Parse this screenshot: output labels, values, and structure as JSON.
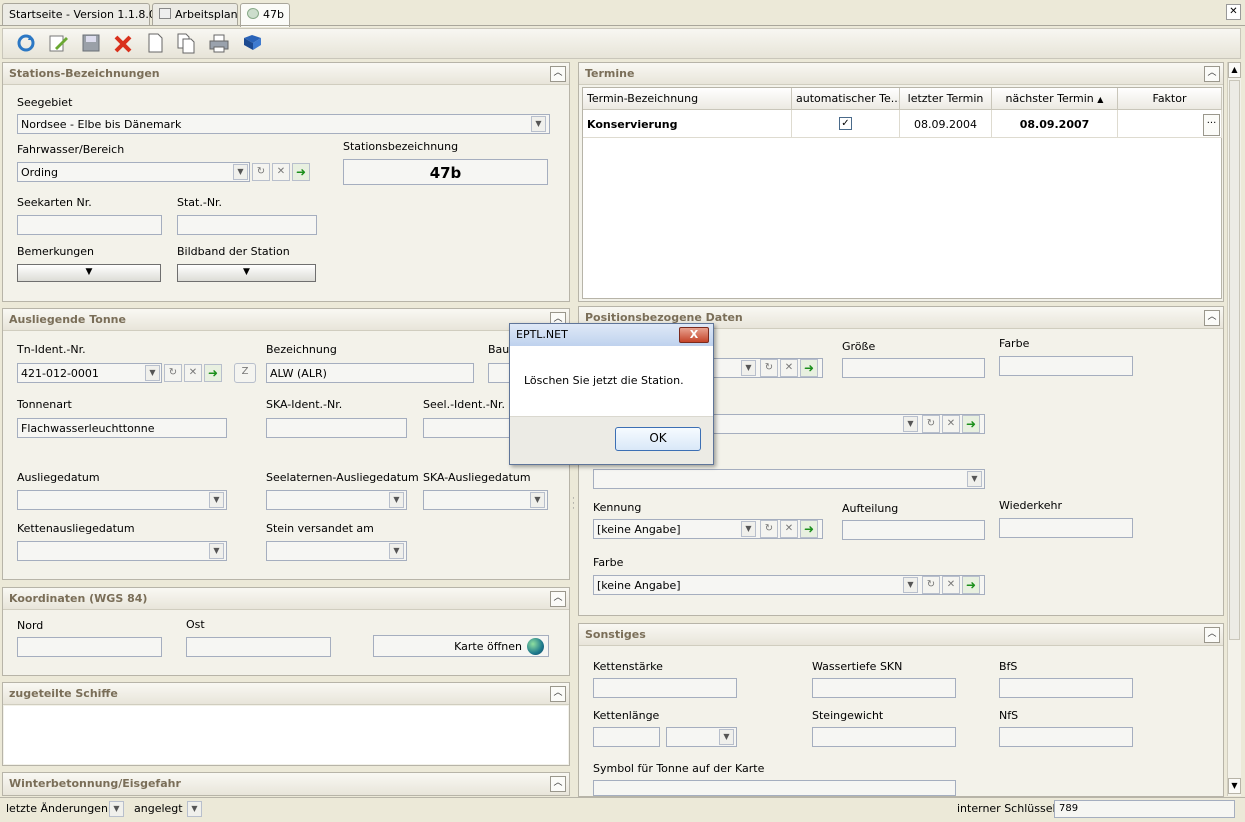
{
  "tabs": [
    {
      "label": "Startseite - Version 1.1.8.0"
    },
    {
      "label": "Arbeitsplan"
    },
    {
      "label": "47b"
    }
  ],
  "window_close": "✕",
  "stations": {
    "title": "Stations-Bezeichnungen",
    "seegebiet_label": "Seegebiet",
    "seegebiet_value": "Nordsee - Elbe bis Dänemark",
    "fahrwasser_label": "Fahrwasser/Bereich",
    "fahrwasser_value": "Ording",
    "stationsbez_label": "Stationsbezeichnung",
    "stationsbez_value": "47b",
    "seekarten_label": "Seekarten Nr.",
    "stat_label": "Stat.-Nr.",
    "bemerkungen_label": "Bemerkungen",
    "bildband_label": "Bildband der Station"
  },
  "tonne": {
    "title": "Ausliegende Tonne",
    "tn_label": "Tn-Ident.-Nr.",
    "tn_value": "421-012-0001",
    "z_label": "Z",
    "bezeichnung_label": "Bezeichnung",
    "bezeichnung_value": "ALW (ALR)",
    "bauj_label": "Bauj",
    "tonnenart_label": "Tonnenart",
    "tonnenart_value": "Flachwasserleuchttonne",
    "ska_ident_label": "SKA-Ident.-Nr.",
    "seel_ident_label": "Seel.-Ident.-Nr.",
    "ausliegedatum_label": "Ausliegedatum",
    "seelaternen_label": "Seelaternen-Ausliegedatum",
    "ska_ausliege_label": "SKA-Ausliegedatum",
    "ketten_label": "Kettenausliegedatum",
    "stein_label": "Stein versandet am"
  },
  "koordinaten": {
    "title": "Koordinaten (WGS 84)",
    "nord_label": "Nord",
    "ost_label": "Ost",
    "karte_label": "Karte öffnen"
  },
  "schiffe": {
    "title": "zugeteilte Schiffe"
  },
  "winter": {
    "title": "Winterbetonnung/Eisgefahr"
  },
  "termine": {
    "title": "Termine",
    "columns": [
      "Termin-Bezeichnung",
      "automatischer Te...",
      "letzter Termin",
      "nächster Termin",
      "Faktor"
    ],
    "row": {
      "bezeichnung": "Konservierung",
      "auto": "✓",
      "letzter": "08.09.2004",
      "naechster": "08.09.2007",
      "more": "···"
    }
  },
  "position": {
    "title": "Positionsbezogene Daten",
    "groesse_label": "Größe",
    "farbe_label": "Farbe",
    "kennung_label": "Kennung",
    "kennung_value": "[keine Angabe]",
    "aufteilung_label": "Aufteilung",
    "wiederkehr_label": "Wiederkehr",
    "farbe2_label": "Farbe",
    "farbe2_value": "[keine Angabe]"
  },
  "sonstiges": {
    "title": "Sonstiges",
    "kettenstaerke_label": "Kettenstärke",
    "wassertiefe_label": "Wassertiefe SKN",
    "bfs_label": "BfS",
    "kettenlaenge_label": "Kettenlänge",
    "steingewicht_label": "Steingewicht",
    "nfs_label": "NfS",
    "symbol_label": "Symbol für Tonne auf der Karte"
  },
  "status": {
    "letzte_label": "letzte Änderungen",
    "angelegt_label": "angelegt",
    "schluessel_label": "interner Schlüssel",
    "schluessel_value": "789"
  },
  "dialog": {
    "title": "EPTL.NET",
    "message": "Löschen Sie jetzt die Station.",
    "ok_label": "OK",
    "close_label": "X"
  },
  "colors": {
    "accent": "#7a6e58",
    "go": "#1b8f1b",
    "delete": "#d9301c"
  }
}
